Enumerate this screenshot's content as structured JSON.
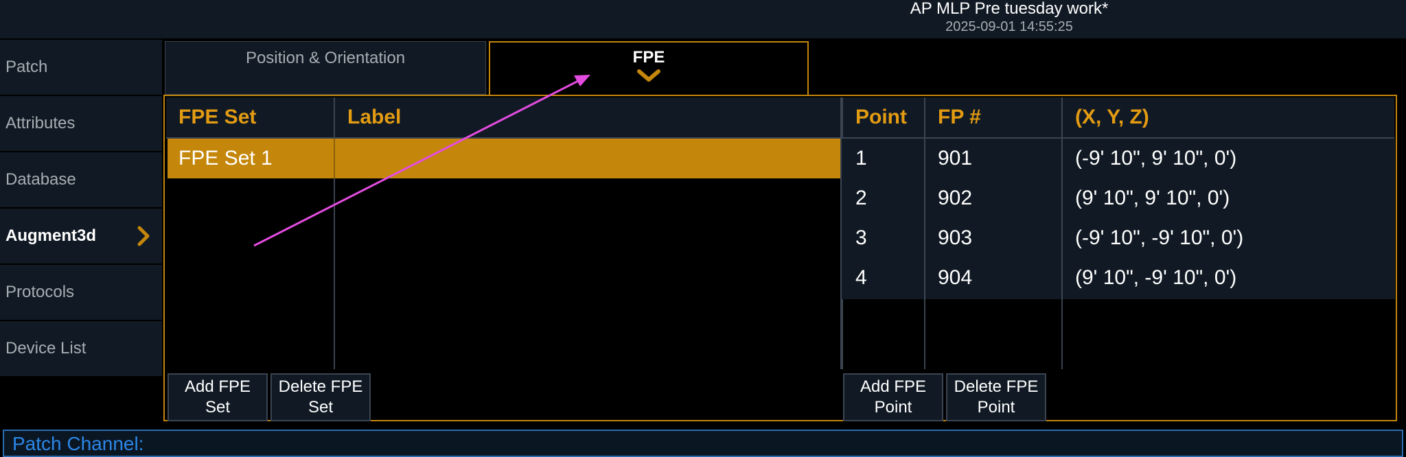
{
  "window": {
    "title": "AP MLP Pre tuesday work*",
    "timestamp": "2025-09-01 14:55:25"
  },
  "sidebar": {
    "items": [
      {
        "label": "Patch"
      },
      {
        "label": "Attributes"
      },
      {
        "label": "Database"
      },
      {
        "label": "Augment3d",
        "active": true
      },
      {
        "label": "Protocols"
      },
      {
        "label": "Device List"
      }
    ]
  },
  "tabs": [
    {
      "label": "Position & Orientation"
    },
    {
      "label": "FPE",
      "active": true
    }
  ],
  "fpe_sets": {
    "headers": {
      "set": "FPE Set",
      "label": "Label"
    },
    "rows": [
      {
        "set": "FPE Set 1",
        "label": "",
        "selected": true
      }
    ],
    "buttons": {
      "add": "Add FPE\nSet",
      "delete": "Delete FPE\nSet"
    }
  },
  "fpe_points": {
    "headers": {
      "point": "Point",
      "fp": "FP #",
      "xyz": "(X, Y, Z)"
    },
    "rows": [
      {
        "point": "1",
        "fp": "901",
        "xyz": "(-9' 10\", 9' 10\", 0')"
      },
      {
        "point": "2",
        "fp": "902",
        "xyz": "(9' 10\", 9' 10\", 0')"
      },
      {
        "point": "3",
        "fp": "903",
        "xyz": "(-9' 10\", -9' 10\", 0')"
      },
      {
        "point": "4",
        "fp": "904",
        "xyz": "(9' 10\", -9' 10\", 0')"
      }
    ],
    "buttons": {
      "add": "Add FPE\nPoint",
      "delete": "Delete FPE\nPoint"
    }
  },
  "command_line": {
    "text": "Patch Channel:"
  },
  "colors": {
    "accent": "#c4870b",
    "header_text": "#e39b12",
    "panel_bg": "#111a24",
    "command_blue": "#2b87e6",
    "annotation": "#e44ce0"
  },
  "icons": {
    "active_sidebar": "chevron-right-icon",
    "active_tab": "chevron-down-icon"
  }
}
